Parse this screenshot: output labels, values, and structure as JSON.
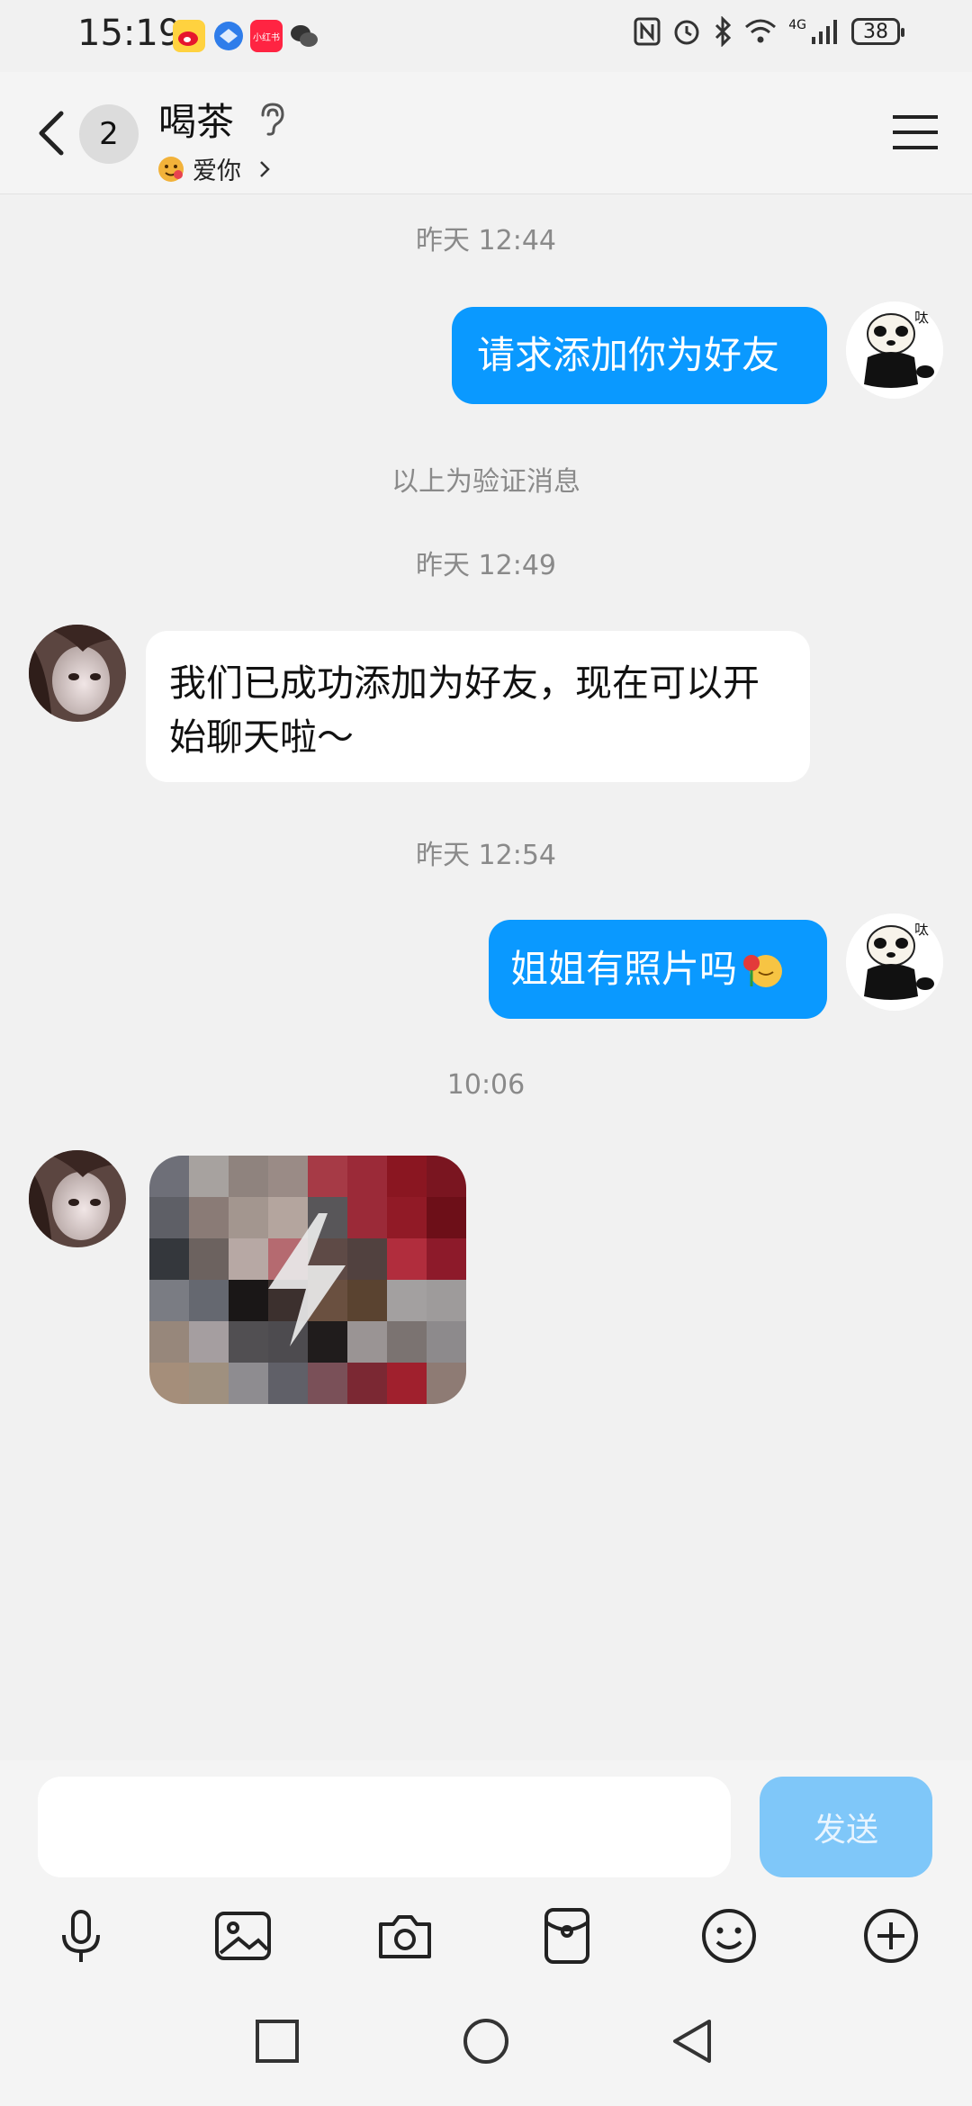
{
  "status_bar": {
    "time": "15:19",
    "battery": "38",
    "network": "4G",
    "app_icons": [
      "weibo-icon",
      "browser-icon",
      "xiaohongshu-icon",
      "wechat-icon"
    ],
    "xiaohongshu_text": "小红书"
  },
  "header": {
    "unread_count": "2",
    "title": "喝茶",
    "subtitle": "爱你"
  },
  "messages": [
    {
      "type": "time",
      "text": "昨天 12:44"
    },
    {
      "type": "sent",
      "text": "请求添加你为好友",
      "avatar_text": "呔"
    },
    {
      "type": "system",
      "text": "以上为验证消息"
    },
    {
      "type": "time",
      "text": "昨天 12:49"
    },
    {
      "type": "received",
      "text": "我们已成功添加为好友，现在可以开始聊天啦～"
    },
    {
      "type": "time",
      "text": "昨天 12:54"
    },
    {
      "type": "sent",
      "text": "姐姐有照片吗",
      "avatar_text": "呔"
    },
    {
      "type": "time",
      "text": "10:06"
    },
    {
      "type": "received_image",
      "icon": "flash-photo-icon"
    }
  ],
  "input": {
    "placeholder": "",
    "send_label": "发送"
  },
  "toolbar": [
    "microphone-icon",
    "image-icon",
    "camera-icon",
    "red-packet-icon",
    "emoji-icon",
    "plus-icon"
  ],
  "colors": {
    "bubble_sent": "#0a99ff",
    "send_disabled": "#7fc7f9",
    "background": "#f1f1f1"
  }
}
